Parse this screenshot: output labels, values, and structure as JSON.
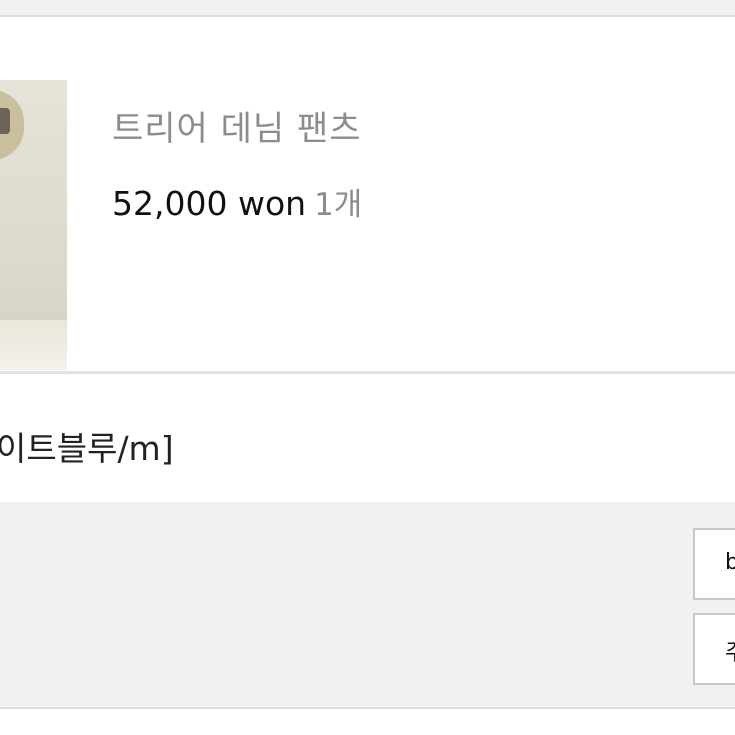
{
  "product": {
    "name": "트리어 데님 팬츠",
    "price": "52,000 won",
    "quantity": "1개"
  },
  "option": {
    "text": "이트블루/m]"
  },
  "actions": {
    "button_1_label": "b",
    "button_2_label": "주"
  }
}
